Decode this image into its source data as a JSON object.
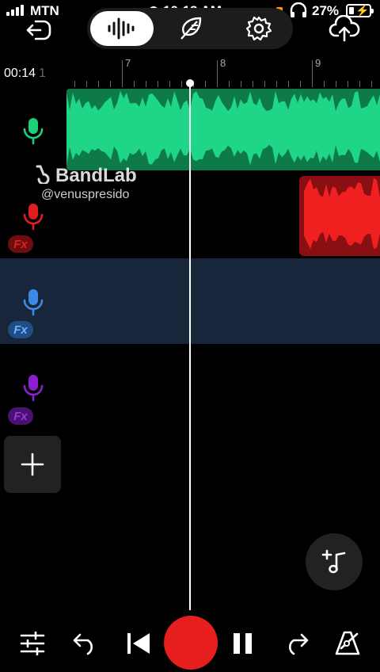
{
  "status_bar": {
    "carrier": "MTN",
    "time": "10:13 AM",
    "battery_percent": "27%",
    "battery_level": 0.27
  },
  "toolbar": {
    "back_icon": "exit-icon",
    "mode_icon": "waveform-icon",
    "edit_icon": "feather-icon",
    "settings_icon": "gear-icon",
    "upload_icon": "cloud-upload-icon"
  },
  "timeline": {
    "position": "00:14",
    "beat": "1",
    "bar_numbers": [
      "7",
      "8",
      "9"
    ]
  },
  "tracks": [
    {
      "name": "track-1",
      "color": "#1ecf7a",
      "fx": false,
      "region_color": "#0e7a48"
    },
    {
      "name": "track-2",
      "color": "#e11d1d",
      "fx": true,
      "fx_label": "Fx",
      "region_color": "#8a0f12"
    },
    {
      "name": "track-3",
      "color": "#3d8ae6",
      "fx": true,
      "fx_label": "Fx",
      "selected": true
    },
    {
      "name": "track-4",
      "color": "#8a1fcf",
      "fx": true,
      "fx_label": "Fx"
    }
  ],
  "watermark": {
    "brand": "BandLab",
    "user": "@venuspresido"
  },
  "bottom_bar": {
    "items": [
      "mixer-icon",
      "undo-icon",
      "skip-back-icon",
      "record-button",
      "pause-icon",
      "redo-icon",
      "metronome-icon"
    ]
  },
  "colors": {
    "record": "#e61e1e",
    "selected_row": "#17263a"
  }
}
